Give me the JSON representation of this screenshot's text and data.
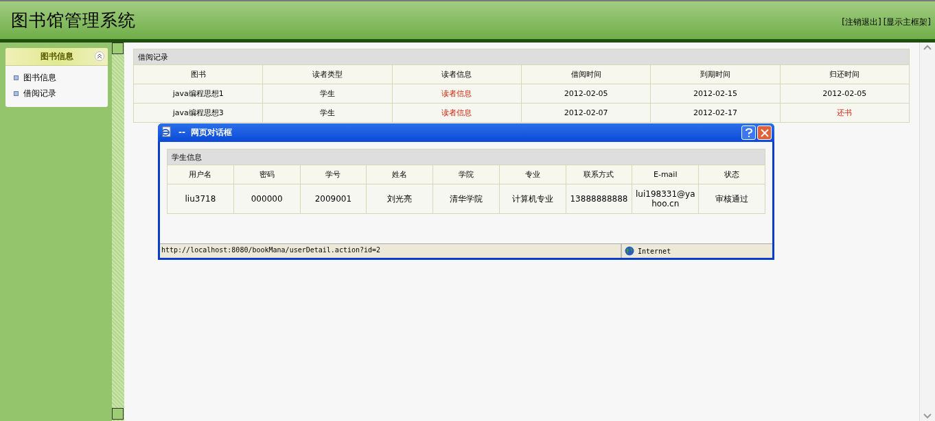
{
  "header": {
    "title": "图书馆管理系统",
    "links": [
      "[注销退出]",
      "[显示主框架]"
    ]
  },
  "sidebar": {
    "title": "图书信息",
    "expanded": true,
    "items": [
      {
        "label": "图书信息"
      },
      {
        "label": "借阅记录"
      }
    ]
  },
  "table": {
    "title": "借阅记录",
    "columns": [
      "图书",
      "读者类型",
      "读者信息",
      "借阅时间",
      "到期时间",
      "归还时间"
    ],
    "rows": [
      [
        {
          "text": "java编程思想1",
          "kind": "text"
        },
        {
          "text": "学生",
          "kind": "text"
        },
        {
          "text": "读者信息",
          "kind": "link"
        },
        {
          "text": "2012-02-05",
          "kind": "text"
        },
        {
          "text": "2012-02-15",
          "kind": "text"
        },
        {
          "text": "2012-02-05",
          "kind": "text"
        }
      ],
      [
        {
          "text": "java编程思想3",
          "kind": "text"
        },
        {
          "text": "学生",
          "kind": "text"
        },
        {
          "text": "读者信息",
          "kind": "link"
        },
        {
          "text": "2012-02-07",
          "kind": "text"
        },
        {
          "text": "2012-02-17",
          "kind": "text"
        },
        {
          "text": "还书",
          "kind": "link"
        }
      ]
    ]
  },
  "dialog": {
    "title": "--  网页对话框",
    "table": {
      "title": "学生信息",
      "columns": [
        "用户名",
        "密码",
        "学号",
        "姓名",
        "学院",
        "专业",
        "联系方式",
        "E-mail",
        "状态"
      ],
      "rows": [
        [
          "liu3718",
          "000000",
          "2009001",
          "刘光亮",
          "清华学院",
          "计算机专业",
          "13888888888",
          "lui198331@yahoo.cn",
          "审核通过"
        ]
      ]
    },
    "status_bar": {
      "url": "http://localhost:8080/bookMana/userDetail.action?id=2",
      "zone": "Internet"
    }
  }
}
